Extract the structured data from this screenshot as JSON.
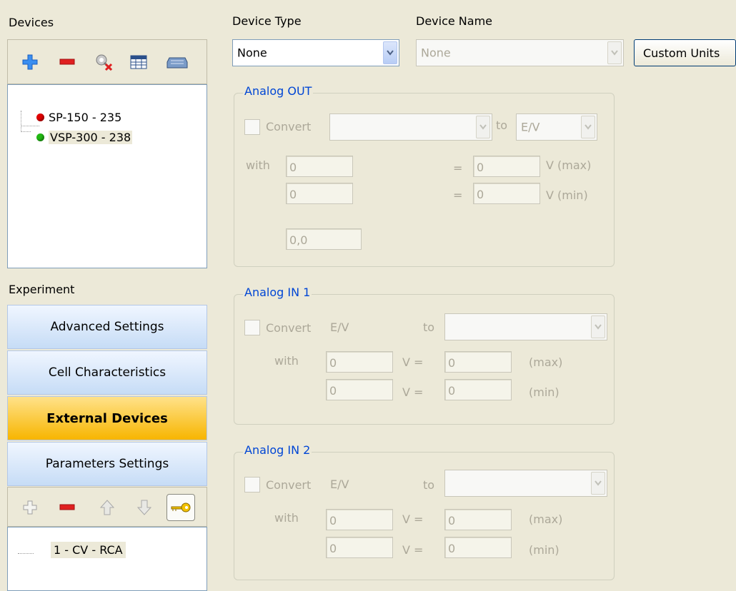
{
  "devices_panel": {
    "title": "Devices",
    "toolbar": {
      "add_icon": "plus-icon",
      "remove_icon": "minus-icon",
      "settings_icon": "wrench-icon",
      "table_icon": "table-icon",
      "device_icon": "device-icon"
    },
    "items": [
      {
        "label": "SP-150 - 235",
        "status_color": "#e00000"
      },
      {
        "label": "VSP-300 - 238",
        "status_color": "#22b814"
      }
    ]
  },
  "experiment_panel": {
    "title": "Experiment",
    "nav": [
      {
        "label": "Advanced Settings",
        "active": false
      },
      {
        "label": "Cell Characteristics",
        "active": false
      },
      {
        "label": "External Devices",
        "active": true
      },
      {
        "label": "Parameters Settings",
        "active": false
      }
    ],
    "toolbar": {
      "add_icon": "plus-outline-icon",
      "remove_icon": "minus-icon",
      "up_icon": "arrow-up-icon",
      "down_icon": "arrow-down-icon",
      "key_icon": "key-icon"
    },
    "items": [
      {
        "label": "1 - CV - RCA"
      }
    ]
  },
  "device_type": {
    "label": "Device Type",
    "value": "None"
  },
  "device_name": {
    "label": "Device Name",
    "value": "None"
  },
  "custom_units_button": "Custom Units",
  "analog_out": {
    "title": "Analog OUT",
    "convert_label": "Convert",
    "convert_from": "",
    "to_label": "to",
    "to_value": "E/V",
    "with_label": "with",
    "max_input": "0",
    "max_value": "0",
    "max_unit": "V (max)",
    "min_input": "0",
    "min_value": "0",
    "min_unit": "V (min)",
    "equals": "=",
    "offset_value": "0,0"
  },
  "analog_in_1": {
    "title": "Analog IN 1",
    "convert_label": "Convert",
    "from_label": "E/V",
    "to_label": "to",
    "to_value": "",
    "with_label": "with",
    "max_v": "0",
    "max_value": "0",
    "max_label": "(max)",
    "min_v": "0",
    "min_value": "0",
    "min_label": "(min)",
    "v_equals": "V  ="
  },
  "analog_in_2": {
    "title": "Analog IN 2",
    "convert_label": "Convert",
    "from_label": "E/V",
    "to_label": "to",
    "to_value": "",
    "with_label": "with",
    "max_v": "0",
    "max_value": "0",
    "max_label": "(max)",
    "min_v": "0",
    "min_value": "0",
    "min_label": "(min)",
    "v_equals": "V  ="
  }
}
